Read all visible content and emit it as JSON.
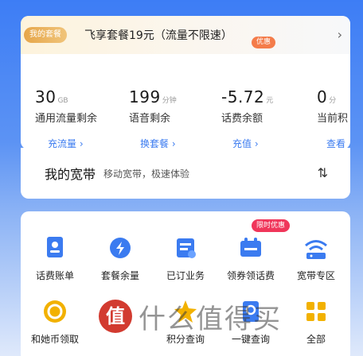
{
  "plan": {
    "badge": "我的套餐",
    "name": "飞享套餐19元（流量不限速）",
    "arrow": "›"
  },
  "stats": [
    {
      "num": "30",
      "unit": "GB",
      "label": "通用流量剩余",
      "action": "充流量 ›"
    },
    {
      "num": "199",
      "unit": "分钟",
      "label": "语音剩余",
      "action": "换套餐 ›"
    },
    {
      "num": "-5.72",
      "unit": "元",
      "label": "话费余额",
      "action": "充值 ›"
    },
    {
      "num": "0",
      "unit": "分",
      "label": "当前积",
      "action": "查看"
    }
  ],
  "float_tag": "优惠",
  "broadband": {
    "title": "我的宽带",
    "desc": "移动宽带，极速体验",
    "icon": "⇅"
  },
  "services": {
    "hot_tag": "限时优惠",
    "items": [
      {
        "label": "话费账单",
        "icon": "bill-icon",
        "color": "#3b7bf0"
      },
      {
        "label": "套餐余量",
        "icon": "balance-icon",
        "color": "#3b7bf0"
      },
      {
        "label": "已订业务",
        "icon": "subscribed-icon",
        "color": "#3b7bf0"
      },
      {
        "label": "领券领话费",
        "icon": "coupon-icon",
        "color": "#3b7bf0"
      },
      {
        "label": "宽带专区",
        "icon": "wifi-icon",
        "color": "#3b7bf0"
      },
      {
        "label": "和她币领取",
        "icon": "coin-icon",
        "color": "#f2b100"
      },
      {
        "label": "",
        "icon": "gift-icon",
        "color": "#3b7bf0"
      },
      {
        "label": "积分查询",
        "icon": "points-icon",
        "color": "#f2b100"
      },
      {
        "label": "一键查询",
        "icon": "query-icon",
        "color": "#3b7bf0"
      },
      {
        "label": "全部",
        "icon": "grid-icon",
        "color": "#f2b100"
      }
    ]
  },
  "watermark": {
    "badge": "值",
    "text": "什么值得买"
  }
}
